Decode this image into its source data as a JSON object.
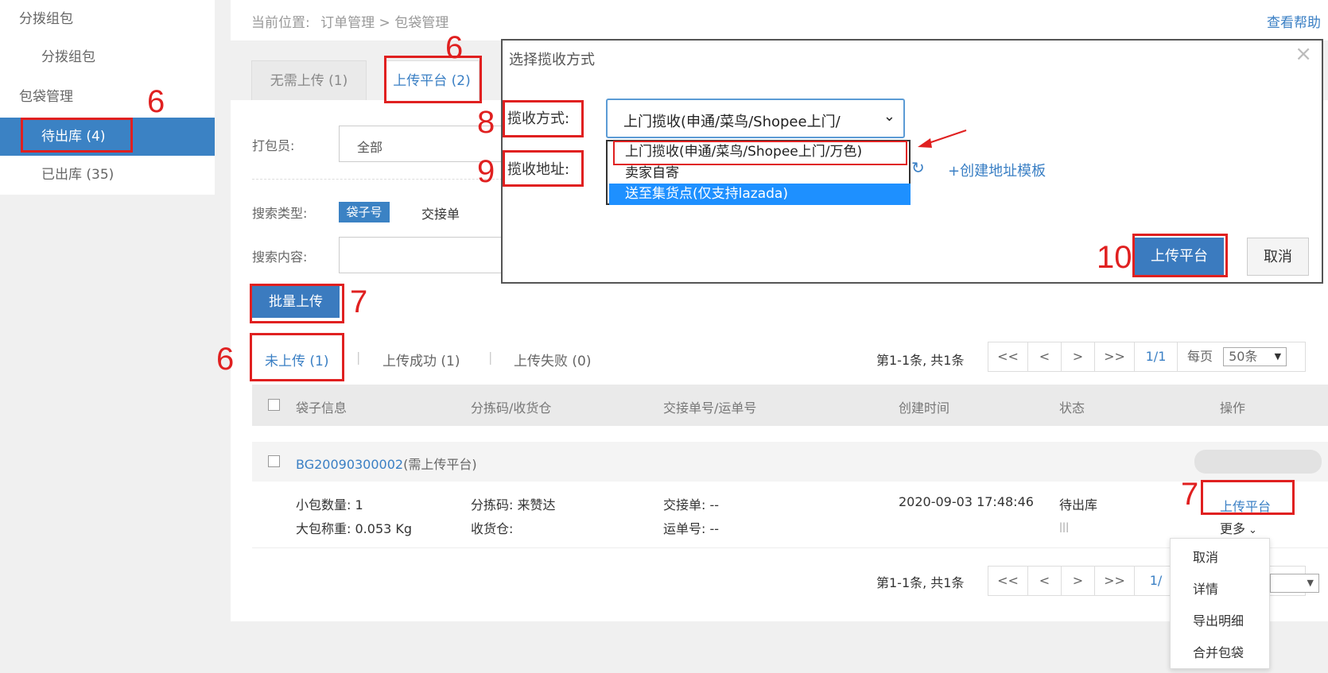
{
  "sidebar": {
    "group1": "分拨组包",
    "group1_sub": "分拨组包",
    "group2": "包袋管理",
    "pending": "待出库 (4)",
    "shipped": "已出库 (35)"
  },
  "breadcrumb": {
    "prefix": "当前位置:",
    "path": "订单管理 > 包袋管理",
    "help": "查看帮助"
  },
  "tabs": {
    "no_upload": "无需上传 (1)",
    "upload_platform": "上传平台 (2)"
  },
  "filters": {
    "packer_label": "打包员:",
    "packer_value": "全部",
    "search_type_label": "搜索类型:",
    "search_type_active": "袋子号",
    "search_type_other": "交接单",
    "search_content_label": "搜索内容:"
  },
  "batch_upload": "批量上传",
  "status_tabs": {
    "not_uploaded": "未上传 (1)",
    "success": "上传成功 (1)",
    "failed": "上传失败 (0)"
  },
  "pagination": {
    "summary": "第1-1条, 共1条",
    "first": "<<",
    "prev": "<",
    "next": ">",
    "last": ">>",
    "page": "1/1",
    "per_page_label": "每页",
    "per_page_value": "50条",
    "page_partial": "1/"
  },
  "table": {
    "headers": [
      "袋子信息",
      "分拣码/收货仓",
      "交接单号/运单号",
      "创建时间",
      "状态",
      "操作"
    ]
  },
  "row": {
    "bag_id": "BG20090300002",
    "bag_note": "(需上传平台)",
    "count_label": "小包数量:",
    "count_value": "1",
    "weight_label": "大包称重:",
    "weight_value": "0.053 Kg",
    "sort_label": "分拣码:",
    "sort_value": "来赞达",
    "warehouse_label": "收货仓:",
    "handover_label": "交接单:",
    "handover_value": "--",
    "waybill_label": "运单号:",
    "waybill_value": "--",
    "created": "2020-09-03 17:48:46",
    "status": "待出库",
    "action_upload": "上传平台",
    "action_more": "更多"
  },
  "more_menu": [
    "取消",
    "详情",
    "导出明细",
    "合并包袋"
  ],
  "modal": {
    "title": "选择揽收方式",
    "method_label": "揽收方式:",
    "method_selected": "上门揽收(申通/菜鸟/Shopee上门/",
    "options": [
      "上门揽收(申通/菜鸟/Shopee上门/万色)",
      "卖家自寄",
      "送至集货点(仅支持lazada)"
    ],
    "address_label": "揽收地址:",
    "create_template": "+创建地址模板",
    "submit": "上传平台",
    "cancel": "取消",
    "close": "×"
  },
  "annotations": {
    "n6a": "6",
    "n6b": "6",
    "n6c": "6",
    "n7a": "7",
    "n7b": "7",
    "n8": "8",
    "n9": "9",
    "n10": "10"
  },
  "colors": {
    "accent": "#3b7bbf",
    "annotation": "#e02020",
    "link": "#3a7fc4"
  }
}
